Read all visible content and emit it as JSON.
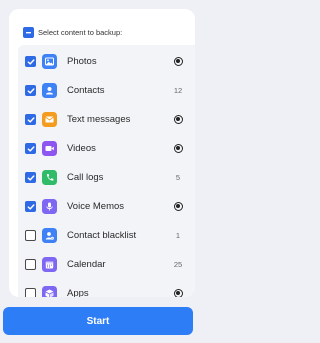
{
  "header": {
    "label": "Select content to backup:",
    "state": "partial"
  },
  "items": [
    {
      "label": "Photos",
      "checked": true,
      "status": "loading",
      "count": "",
      "icon": "photos-icon",
      "color": "#3e82f5"
    },
    {
      "label": "Contacts",
      "checked": true,
      "status": "count",
      "count": "12",
      "icon": "contacts-icon",
      "color": "#3e82f5"
    },
    {
      "label": "Text messages",
      "checked": true,
      "status": "loading",
      "count": "",
      "icon": "messages-icon",
      "color": "#f39c1f"
    },
    {
      "label": "Videos",
      "checked": true,
      "status": "loading",
      "count": "",
      "icon": "videos-icon",
      "color": "#8e56f1"
    },
    {
      "label": "Call logs",
      "checked": true,
      "status": "count",
      "count": "5",
      "icon": "call-logs-icon",
      "color": "#2fbb67"
    },
    {
      "label": "Voice Memos",
      "checked": true,
      "status": "loading",
      "count": "",
      "icon": "voice-memos-icon",
      "color": "#7e67f2"
    },
    {
      "label": "Contact blacklist",
      "checked": false,
      "status": "count",
      "count": "1",
      "icon": "contact-blacklist-icon",
      "color": "#3e82f5"
    },
    {
      "label": "Calendar",
      "checked": false,
      "status": "count",
      "count": "25",
      "icon": "calendar-icon",
      "color": "#7e67f2"
    },
    {
      "label": "Apps",
      "checked": false,
      "status": "loading",
      "count": "",
      "icon": "apps-icon",
      "color": "#7e67f2"
    }
  ],
  "start_button": {
    "label": "Start"
  },
  "colors": {
    "accent": "#2f6ae6",
    "button": "#2c7df6"
  }
}
